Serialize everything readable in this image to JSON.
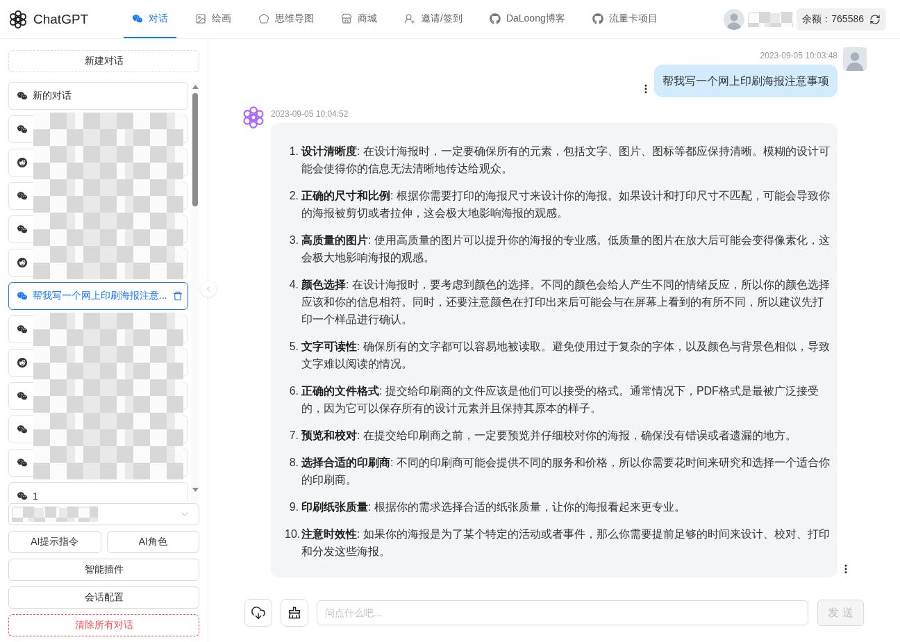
{
  "header": {
    "brand": "ChatGPT",
    "nav": [
      {
        "label": "对话",
        "selected": true
      },
      {
        "label": "绘画",
        "selected": false
      },
      {
        "label": "思维导图",
        "selected": false
      },
      {
        "label": "商城",
        "selected": false
      },
      {
        "label": "邀请/签到",
        "selected": false
      },
      {
        "label": "DaLoong博客",
        "selected": false
      },
      {
        "label": "流量卡项目",
        "selected": false
      }
    ],
    "username": {
      "redacted": true
    },
    "balance": "余额：765586"
  },
  "sidebar": {
    "new_chat": "新建对话",
    "conversations": [
      {
        "kind": "chat",
        "title": "新的对话",
        "selected": false,
        "redacted": false
      },
      {
        "kind": "chat",
        "selected": false,
        "redacted": true
      },
      {
        "kind": "role",
        "selected": false,
        "redacted": true
      },
      {
        "kind": "chat",
        "selected": false,
        "redacted": true
      },
      {
        "kind": "chat",
        "selected": false,
        "redacted": true
      },
      {
        "kind": "role",
        "selected": false,
        "redacted": true
      },
      {
        "kind": "chat",
        "title": "帮我写一个网上印刷海报注意...",
        "selected": true,
        "redacted": false
      },
      {
        "kind": "chat",
        "selected": false,
        "redacted": true
      },
      {
        "kind": "role",
        "selected": false,
        "redacted": true
      },
      {
        "kind": "chat",
        "selected": false,
        "redacted": true
      },
      {
        "kind": "chat",
        "selected": false,
        "redacted": true
      },
      {
        "kind": "chat",
        "selected": false,
        "redacted": true
      },
      {
        "kind": "chat",
        "title": "1",
        "selected": false,
        "redacted": false
      }
    ],
    "model_select": {
      "redacted": true
    },
    "prompt_buttons": [
      "AI提示指令",
      "AI角色"
    ],
    "plugin_button": "智能插件",
    "settings_button": "会话配置",
    "clear_button": "清除所有对话"
  },
  "chat": {
    "messages": [
      {
        "kind": "user",
        "time": "2023-09-05 10:03:48",
        "text": "帮我写一个网上印刷海报注意事项"
      },
      {
        "kind": "assistant",
        "time": "2023-09-05 10:04:52",
        "items": [
          {
            "number": "1.",
            "text": "**设计清晰度**: 在设计海报时，一定要确保所有的元素，包括文字、图片、图标等都应保持清晰。模糊的设计可能会使得你的信息无法清晰地传达给观众。"
          },
          {
            "number": "2.",
            "text": "**正确的尺寸和比例**: 根据你需要打印的海报尺寸来设计你的海报。如果设计和打印尺寸不匹配，可能会导致你的海报被剪切或者拉伸，这会极大地影响海报的观感。"
          },
          {
            "number": "3.",
            "text": "**高质量的图片**: 使用高质量的图片可以提升你的海报的专业感。低质量的图片在放大后可能会变得像素化，这会极大地影响海报的观感。"
          },
          {
            "number": "4.",
            "text": "**颜色选择**: 在设计海报时，要考虑到颜色的选择。不同的颜色会给人产生不同的情绪反应，所以你的颜色选择应该和你的信息相符。同时，还要注意颜色在打印出来后可能会与在屏幕上看到的有所不同，所以建议先打印一个样品进行确认。"
          },
          {
            "number": "5.",
            "text": "**文字可读性**: 确保所有的文字都可以容易地被读取。避免使用过于复杂的字体，以及颜色与背景色相似，导致文字难以阅读的情况。"
          },
          {
            "number": "6.",
            "text": "**正确的文件格式**: 提交给印刷商的文件应该是他们可以接受的格式。通常情况下，PDF格式是最被广泛接受的，因为它可以保存所有的设计元素并且保持其原本的样子。"
          },
          {
            "number": "7.",
            "text": "**预览和校对**: 在提交给印刷商之前，一定要预览并仔细校对你的海报，确保没有错误或者遗漏的地方。"
          },
          {
            "number": "8.",
            "text": "**选择合适的印刷商**: 不同的印刷商可能会提供不同的服务和价格，所以你需要花时间来研究和选择一个适合你的印刷商。"
          },
          {
            "number": "9.",
            "text": "**印刷纸张质量**: 根据你的需求选择合适的纸张质量，让你的海报看起来更专业。"
          },
          {
            "number": "10.",
            "text": "**注意时效性**: 如果你的海报是为了某个特定的活动或者事件，那么你需要提前足够的时间来设计、校对、打印和分发这些海报。"
          }
        ]
      }
    ],
    "input": {
      "placeholder": "问点什么吧..."
    },
    "send_button": {
      "label": "发 送",
      "disabled": true
    }
  }
}
